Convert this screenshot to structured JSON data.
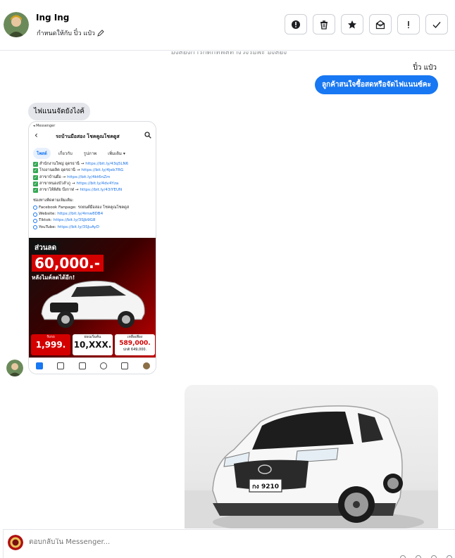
{
  "header": {
    "contact_name": "Ing Ing",
    "assigned_label": "กำหนดให้กับ ปิ๋ว แป๋ว",
    "actions": [
      {
        "name": "mark-spam-button",
        "icon": "alert-circle-icon"
      },
      {
        "name": "delete-button",
        "icon": "trash-icon"
      },
      {
        "name": "star-button",
        "icon": "star-icon"
      },
      {
        "name": "mark-unread-button",
        "icon": "mail-open-icon"
      },
      {
        "name": "follow-up-button",
        "icon": "exclamation-icon"
      },
      {
        "name": "mark-done-button",
        "icon": "check-icon"
      }
    ]
  },
  "conversation": {
    "clipped_note": "ยังสองการกิดกทพลทางวงรยพะ ยังสอง",
    "outgoing_sender": "ปิ๋ว แป๋ว",
    "outgoing_message": "ลูกค้าสนใจซื้อสดหรือจัดไฟแนนซ์คะ",
    "incoming_message": "ไฟแนนจัดยังไงค้",
    "shared_screenshot": {
      "status": "◂ Messenger",
      "page_title": "รถบ้านมือสอง โชคคูณโชคดูส",
      "tabs": [
        "โพสต์",
        "เกี่ยวกับ",
        "รูปภาพ",
        "เพิ่มเติม ▾"
      ],
      "branch_lines": [
        {
          "text": "สำนักงานใหญ่ อุดรธานี → ",
          "link": "https://bit.ly/43q5LN6"
        },
        {
          "text": "โรงงานผลิต อุดรธานี → ",
          "link": "https://bit.ly/4jeb7RG"
        },
        {
          "text": "สาขาบ้านผือ → ",
          "link": "https://bit.ly/4kt6nZm"
        },
        {
          "text": "สาขาหนองบัวลำภู → ",
          "link": "https://bit.ly/4dv4Yza"
        },
        {
          "text": "สาขาโพ้พิสัย บึงกาฬ → ",
          "link": "https://bit.ly/43iYEUN"
        }
      ],
      "contact_heading": "ช่องทางติดตามเพิ่มเติม:",
      "contact_lines": [
        {
          "text": "Facebook Fanpage: ",
          "link": "รถยนต์มือสอง โชคคูณโชคดูส"
        },
        {
          "text": "Website: ",
          "link": "https://bit.ly/4rnw8DB4"
        },
        {
          "text": "Tiktok: ",
          "link": "https://bit.ly/3SJb9G8"
        },
        {
          "text": "YouTube: ",
          "link": "https://bit.ly/3SJuAyD"
        }
      ],
      "promo": {
        "label": "ส่วนลด",
        "amount": "60,000.-",
        "subline": "หลังไมค์ลดได้อีก!",
        "down_label": "รับรถ",
        "down_amount": "1,999.",
        "installment_label": "ผ่อนเริ่มต้น",
        "installment_amount": "10,XXX.",
        "price_label": "เหลือเพียง",
        "price_now": "589,000.",
        "price_before": "ปกติ 649,000."
      },
      "bottom_nav": [
        "หน้าแรก",
        "วิดีโอ",
        "Marketplace",
        "กลุ่ม",
        "การแจ้งเตือน",
        "เมนู"
      ]
    },
    "car_photo": {
      "plate": "กง 9210"
    }
  },
  "composer": {
    "placeholder": "ตอบกลับใน Messenger..."
  },
  "colors": {
    "accent": "#1877f2",
    "bubble_in": "#e4e6eb",
    "promo_red": "#d40000"
  }
}
